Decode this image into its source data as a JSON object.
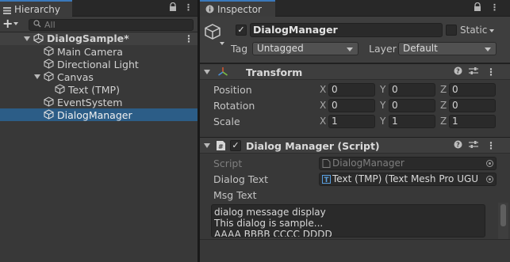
{
  "hierarchy": {
    "tab_label": "Hierarchy",
    "search_placeholder": "All",
    "scene_name": "DialogSample*",
    "items": [
      {
        "label": "Main Camera"
      },
      {
        "label": "Directional Light"
      },
      {
        "label": "Canvas"
      },
      {
        "label": "Text (TMP)"
      },
      {
        "label": "EventSystem"
      },
      {
        "label": "DialogManager"
      }
    ],
    "selected": "DialogManager"
  },
  "inspector": {
    "tab_label": "Inspector",
    "object_name": "DialogManager",
    "static_label": "Static",
    "tag_label": "Tag",
    "tag_value": "Untagged",
    "layer_label": "Layer",
    "layer_value": "Default",
    "transform": {
      "title": "Transform",
      "rows": [
        {
          "label": "Position",
          "x": "0",
          "y": "0",
          "z": "0"
        },
        {
          "label": "Rotation",
          "x": "0",
          "y": "0",
          "z": "0"
        },
        {
          "label": "Scale",
          "x": "1",
          "y": "1",
          "z": "1"
        }
      ],
      "axis_x": "X",
      "axis_y": "Y",
      "axis_z": "Z"
    },
    "script_component": {
      "title": "Dialog Manager (Script)",
      "script_label": "Script",
      "script_value": "DialogManager",
      "dialog_text_label": "Dialog Text",
      "dialog_text_value": "Text (TMP) (Text Mesh Pro UGU",
      "msg_text_label": "Msg Text",
      "msg_text_lines": [
        "dialog message display",
        "This dialog is sample...",
        "AAAA BBBB CCCC DDDD"
      ]
    }
  },
  "colors": {
    "selection": "#2c5d87",
    "tab_accent": "#3a79bb",
    "transform_icon": "#d0542f"
  }
}
